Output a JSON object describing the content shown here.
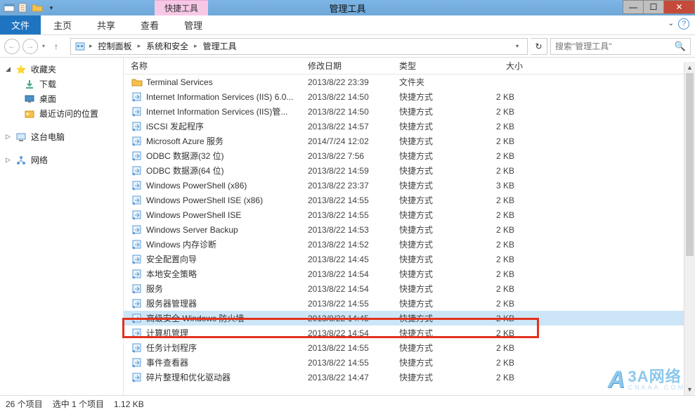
{
  "titlebar": {
    "contextTab": "快捷工具",
    "title": "管理工具"
  },
  "ribbon": {
    "file": "文件",
    "tabs": [
      "主页",
      "共享",
      "查看",
      "管理"
    ]
  },
  "breadcrumb": {
    "segments": [
      "控制面板",
      "系统和安全",
      "管理工具"
    ]
  },
  "search": {
    "placeholder": "搜索\"管理工具\""
  },
  "sidebar": {
    "favorites": {
      "label": "收藏夹",
      "items": [
        "下载",
        "桌面",
        "最近访问的位置"
      ]
    },
    "computer": {
      "label": "这台电脑"
    },
    "network": {
      "label": "网络"
    }
  },
  "columns": {
    "name": "名称",
    "date": "修改日期",
    "type": "类型",
    "size": "大小"
  },
  "files": [
    {
      "name": "Terminal Services",
      "date": "2013/8/22 23:39",
      "type": "文件夹",
      "size": "",
      "icon": "folder"
    },
    {
      "name": "Internet Information Services (IIS) 6.0...",
      "date": "2013/8/22 14:50",
      "type": "快捷方式",
      "size": "2 KB",
      "icon": "link"
    },
    {
      "name": "Internet Information Services (IIS)管...",
      "date": "2013/8/22 14:50",
      "type": "快捷方式",
      "size": "2 KB",
      "icon": "link"
    },
    {
      "name": "iSCSI 发起程序",
      "date": "2013/8/22 14:57",
      "type": "快捷方式",
      "size": "2 KB",
      "icon": "link"
    },
    {
      "name": "Microsoft Azure 服务",
      "date": "2014/7/24 12:02",
      "type": "快捷方式",
      "size": "2 KB",
      "icon": "link"
    },
    {
      "name": "ODBC 数据源(32 位)",
      "date": "2013/8/22 7:56",
      "type": "快捷方式",
      "size": "2 KB",
      "icon": "link"
    },
    {
      "name": "ODBC 数据源(64 位)",
      "date": "2013/8/22 14:59",
      "type": "快捷方式",
      "size": "2 KB",
      "icon": "link"
    },
    {
      "name": "Windows PowerShell (x86)",
      "date": "2013/8/22 23:37",
      "type": "快捷方式",
      "size": "3 KB",
      "icon": "link"
    },
    {
      "name": "Windows PowerShell ISE (x86)",
      "date": "2013/8/22 14:55",
      "type": "快捷方式",
      "size": "2 KB",
      "icon": "link"
    },
    {
      "name": "Windows PowerShell ISE",
      "date": "2013/8/22 14:55",
      "type": "快捷方式",
      "size": "2 KB",
      "icon": "link"
    },
    {
      "name": "Windows Server Backup",
      "date": "2013/8/22 14:53",
      "type": "快捷方式",
      "size": "2 KB",
      "icon": "link"
    },
    {
      "name": "Windows 内存诊断",
      "date": "2013/8/22 14:52",
      "type": "快捷方式",
      "size": "2 KB",
      "icon": "link"
    },
    {
      "name": "安全配置向导",
      "date": "2013/8/22 14:45",
      "type": "快捷方式",
      "size": "2 KB",
      "icon": "link"
    },
    {
      "name": "本地安全策略",
      "date": "2013/8/22 14:54",
      "type": "快捷方式",
      "size": "2 KB",
      "icon": "link"
    },
    {
      "name": "服务",
      "date": "2013/8/22 14:54",
      "type": "快捷方式",
      "size": "2 KB",
      "icon": "link"
    },
    {
      "name": "服务器管理器",
      "date": "2013/8/22 14:55",
      "type": "快捷方式",
      "size": "2 KB",
      "icon": "link"
    },
    {
      "name": "高级安全 Windows 防火墙",
      "date": "2013/8/22 14:45",
      "type": "快捷方式",
      "size": "2 KB",
      "icon": "link",
      "selected": true
    },
    {
      "name": "计算机管理",
      "date": "2013/8/22 14:54",
      "type": "快捷方式",
      "size": "2 KB",
      "icon": "link"
    },
    {
      "name": "任务计划程序",
      "date": "2013/8/22 14:55",
      "type": "快捷方式",
      "size": "2 KB",
      "icon": "link"
    },
    {
      "name": "事件查看器",
      "date": "2013/8/22 14:55",
      "type": "快捷方式",
      "size": "2 KB",
      "icon": "link"
    },
    {
      "name": "碎片整理和优化驱动器",
      "date": "2013/8/22 14:47",
      "type": "快捷方式",
      "size": "2 KB",
      "icon": "link"
    }
  ],
  "status": {
    "count": "26 个项目",
    "selection": "选中 1 个项目",
    "size": "1.12 KB"
  },
  "watermark": {
    "brand": "3A网络",
    "sub": "CNAAA.COM"
  }
}
